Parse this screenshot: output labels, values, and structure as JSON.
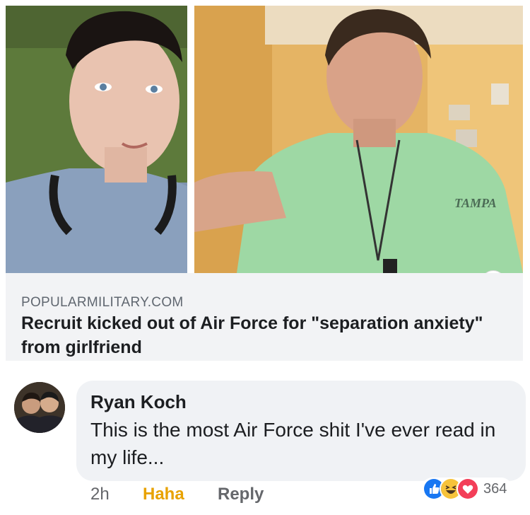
{
  "post": {
    "link_domain": "POPULARMILITARY.COM",
    "link_title": "Recruit kicked out of Air Force for \"separation anxiety\" from girlfriend",
    "shirt_text": "TAMPA"
  },
  "comment": {
    "author": "Ryan Koch",
    "text": "This is the most Air Force shit I've ever read in my life...",
    "timestamp": "2h",
    "reaction_label": "Haha",
    "reply_label": "Reply",
    "reaction_count": "364",
    "reaction_icons": [
      "like-icon",
      "haha-icon",
      "love-icon"
    ]
  },
  "colors": {
    "haha_active": "#e8a200",
    "card_background": "#f2f3f5",
    "like_blue": "#1877f2",
    "love_red": "#f33e58"
  }
}
